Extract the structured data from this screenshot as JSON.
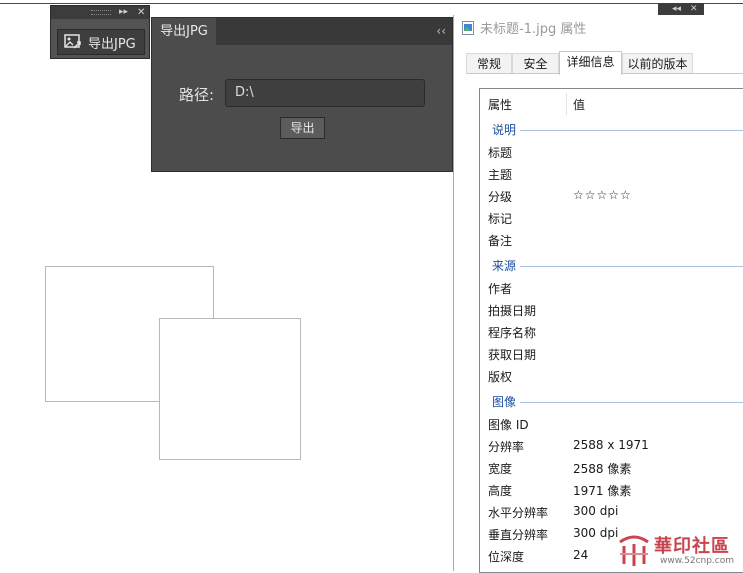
{
  "mini_panel": {
    "button_label": "导出JPG"
  },
  "export_panel": {
    "tab": "导出JPG",
    "path_label": "路径:",
    "path_value": "D:\\",
    "export_button": "导出"
  },
  "properties": {
    "title": "未标题-1.jpg 属性",
    "tabs": [
      "常规",
      "安全",
      "详细信息",
      "以前的版本"
    ],
    "header": {
      "property": "属性",
      "value": "值"
    },
    "groups": {
      "description": "说明",
      "origin": "来源",
      "image": "图像"
    },
    "description_rows": [
      {
        "k": "标题",
        "v": ""
      },
      {
        "k": "主题",
        "v": ""
      },
      {
        "k": "分级",
        "v": "☆☆☆☆☆"
      },
      {
        "k": "标记",
        "v": ""
      },
      {
        "k": "备注",
        "v": ""
      }
    ],
    "origin_rows": [
      {
        "k": "作者",
        "v": ""
      },
      {
        "k": "拍摄日期",
        "v": ""
      },
      {
        "k": "程序名称",
        "v": ""
      },
      {
        "k": "获取日期",
        "v": ""
      },
      {
        "k": "版权",
        "v": ""
      }
    ],
    "image_rows": [
      {
        "k": "图像 ID",
        "v": ""
      },
      {
        "k": "分辨率",
        "v": "2588 x 1971"
      },
      {
        "k": "宽度",
        "v": "2588 像素"
      },
      {
        "k": "高度",
        "v": "1971 像素"
      },
      {
        "k": "水平分辨率",
        "v": "300 dpi"
      },
      {
        "k": "垂直分辨率",
        "v": "300 dpi"
      },
      {
        "k": "位深度",
        "v": "24"
      }
    ]
  },
  "watermark": {
    "text": "華印社區",
    "url": "www.52cnp.com"
  },
  "colors": {
    "ps_panel": "#4c4c4c",
    "group_blue": "#1e4e9c",
    "watermark_red": "#c8454f"
  }
}
